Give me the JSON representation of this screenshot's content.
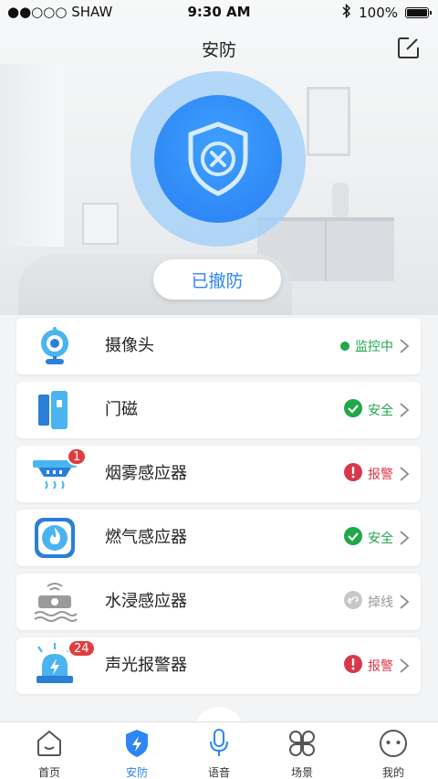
{
  "status_bar": {
    "carrier": "●●○○○ SHAW",
    "time": "9:30 AM",
    "battery": "100%"
  },
  "header": {
    "title": "安防",
    "edit_icon": "edit-icon"
  },
  "security": {
    "state_icon": "shield-x-icon",
    "button_label": "已撤防"
  },
  "devices": [
    {
      "name": "摄像头",
      "icon": "camera-icon",
      "status": "监控中",
      "status_type": "monitoring",
      "badge": ""
    },
    {
      "name": "门磁",
      "icon": "door-sensor-icon",
      "status": "安全",
      "status_type": "safe",
      "badge": ""
    },
    {
      "name": "烟雾感应器",
      "icon": "smoke-detector-icon",
      "status": "报警",
      "status_type": "alarm",
      "badge": "1"
    },
    {
      "name": "燃气感应器",
      "icon": "gas-sensor-icon",
      "status": "安全",
      "status_type": "safe",
      "badge": ""
    },
    {
      "name": "水浸感应器",
      "icon": "water-sensor-icon",
      "status": "掉线",
      "status_type": "offline",
      "badge": ""
    },
    {
      "name": "声光报警器",
      "icon": "siren-icon",
      "status": "报警",
      "status_type": "alarm",
      "badge": "24"
    }
  ],
  "tabs": [
    {
      "label": "首页",
      "icon": "home-icon",
      "active": false
    },
    {
      "label": "安防",
      "icon": "shield-bolt-icon",
      "active": true
    },
    {
      "label": "语音",
      "icon": "microphone-icon",
      "active": false
    },
    {
      "label": "场景",
      "icon": "scene-icon",
      "active": false
    },
    {
      "label": "我的",
      "icon": "profile-icon",
      "active": false
    }
  ],
  "colors": {
    "accent": "#2c86f5",
    "safe": "#1fa84a",
    "alarm": "#d8384b",
    "offline": "#999999"
  }
}
